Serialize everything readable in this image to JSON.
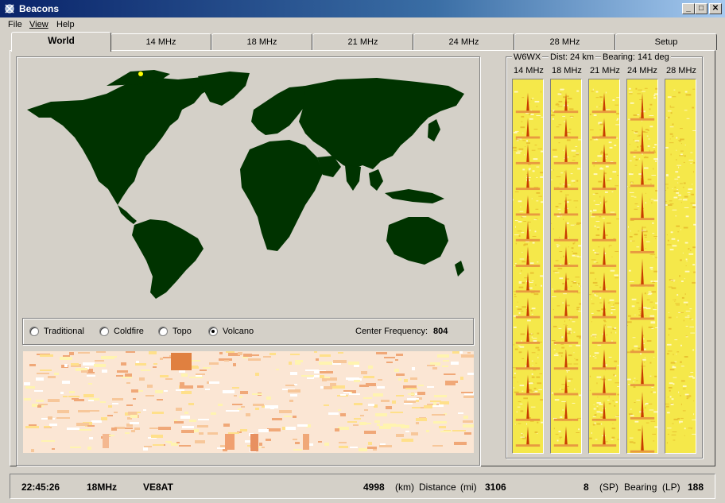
{
  "window": {
    "title": "Beacons",
    "controls": [
      "_",
      "□",
      "✕"
    ]
  },
  "menu": {
    "items": [
      "File",
      "View",
      "Help"
    ]
  },
  "tabs": [
    "World",
    "14 MHz",
    "18 MHz",
    "21 MHz",
    "24 MHz",
    "28 MHz",
    "Setup"
  ],
  "active_tab": "World",
  "display_modes": {
    "options": [
      "Traditional",
      "Coldfire",
      "Topo",
      "Volcano"
    ],
    "selected": "Volcano",
    "center_frequency_label": "Center Frequency:",
    "center_frequency_value": "804"
  },
  "station": {
    "call": "W6WX",
    "distance": "Dist: 24 km",
    "bearing": "Bearing: 141 deg",
    "bands": [
      "14 MHz",
      "18 MHz",
      "21 MHz",
      "24 MHz",
      "28 MHz"
    ]
  },
  "status": {
    "time": "22:45:26",
    "band": "18MHz",
    "callsign": "VE8AT",
    "distance_km": "4998",
    "km_unit": "(km)",
    "distance_label": "Distance",
    "mi_unit": "(mi)",
    "distance_mi": "3106",
    "bearing_sp": "8",
    "sp_label": "(SP)",
    "bearing_label": "Bearing",
    "lp_label": "(LP)",
    "bearing_lp": "188"
  },
  "colors": {
    "land": "#003300",
    "beacon_marker": "#ffff00",
    "signal_peak": "#c83c00",
    "waterfall_bg": "#fbe6d4",
    "band_bg": "#f5e84a"
  }
}
